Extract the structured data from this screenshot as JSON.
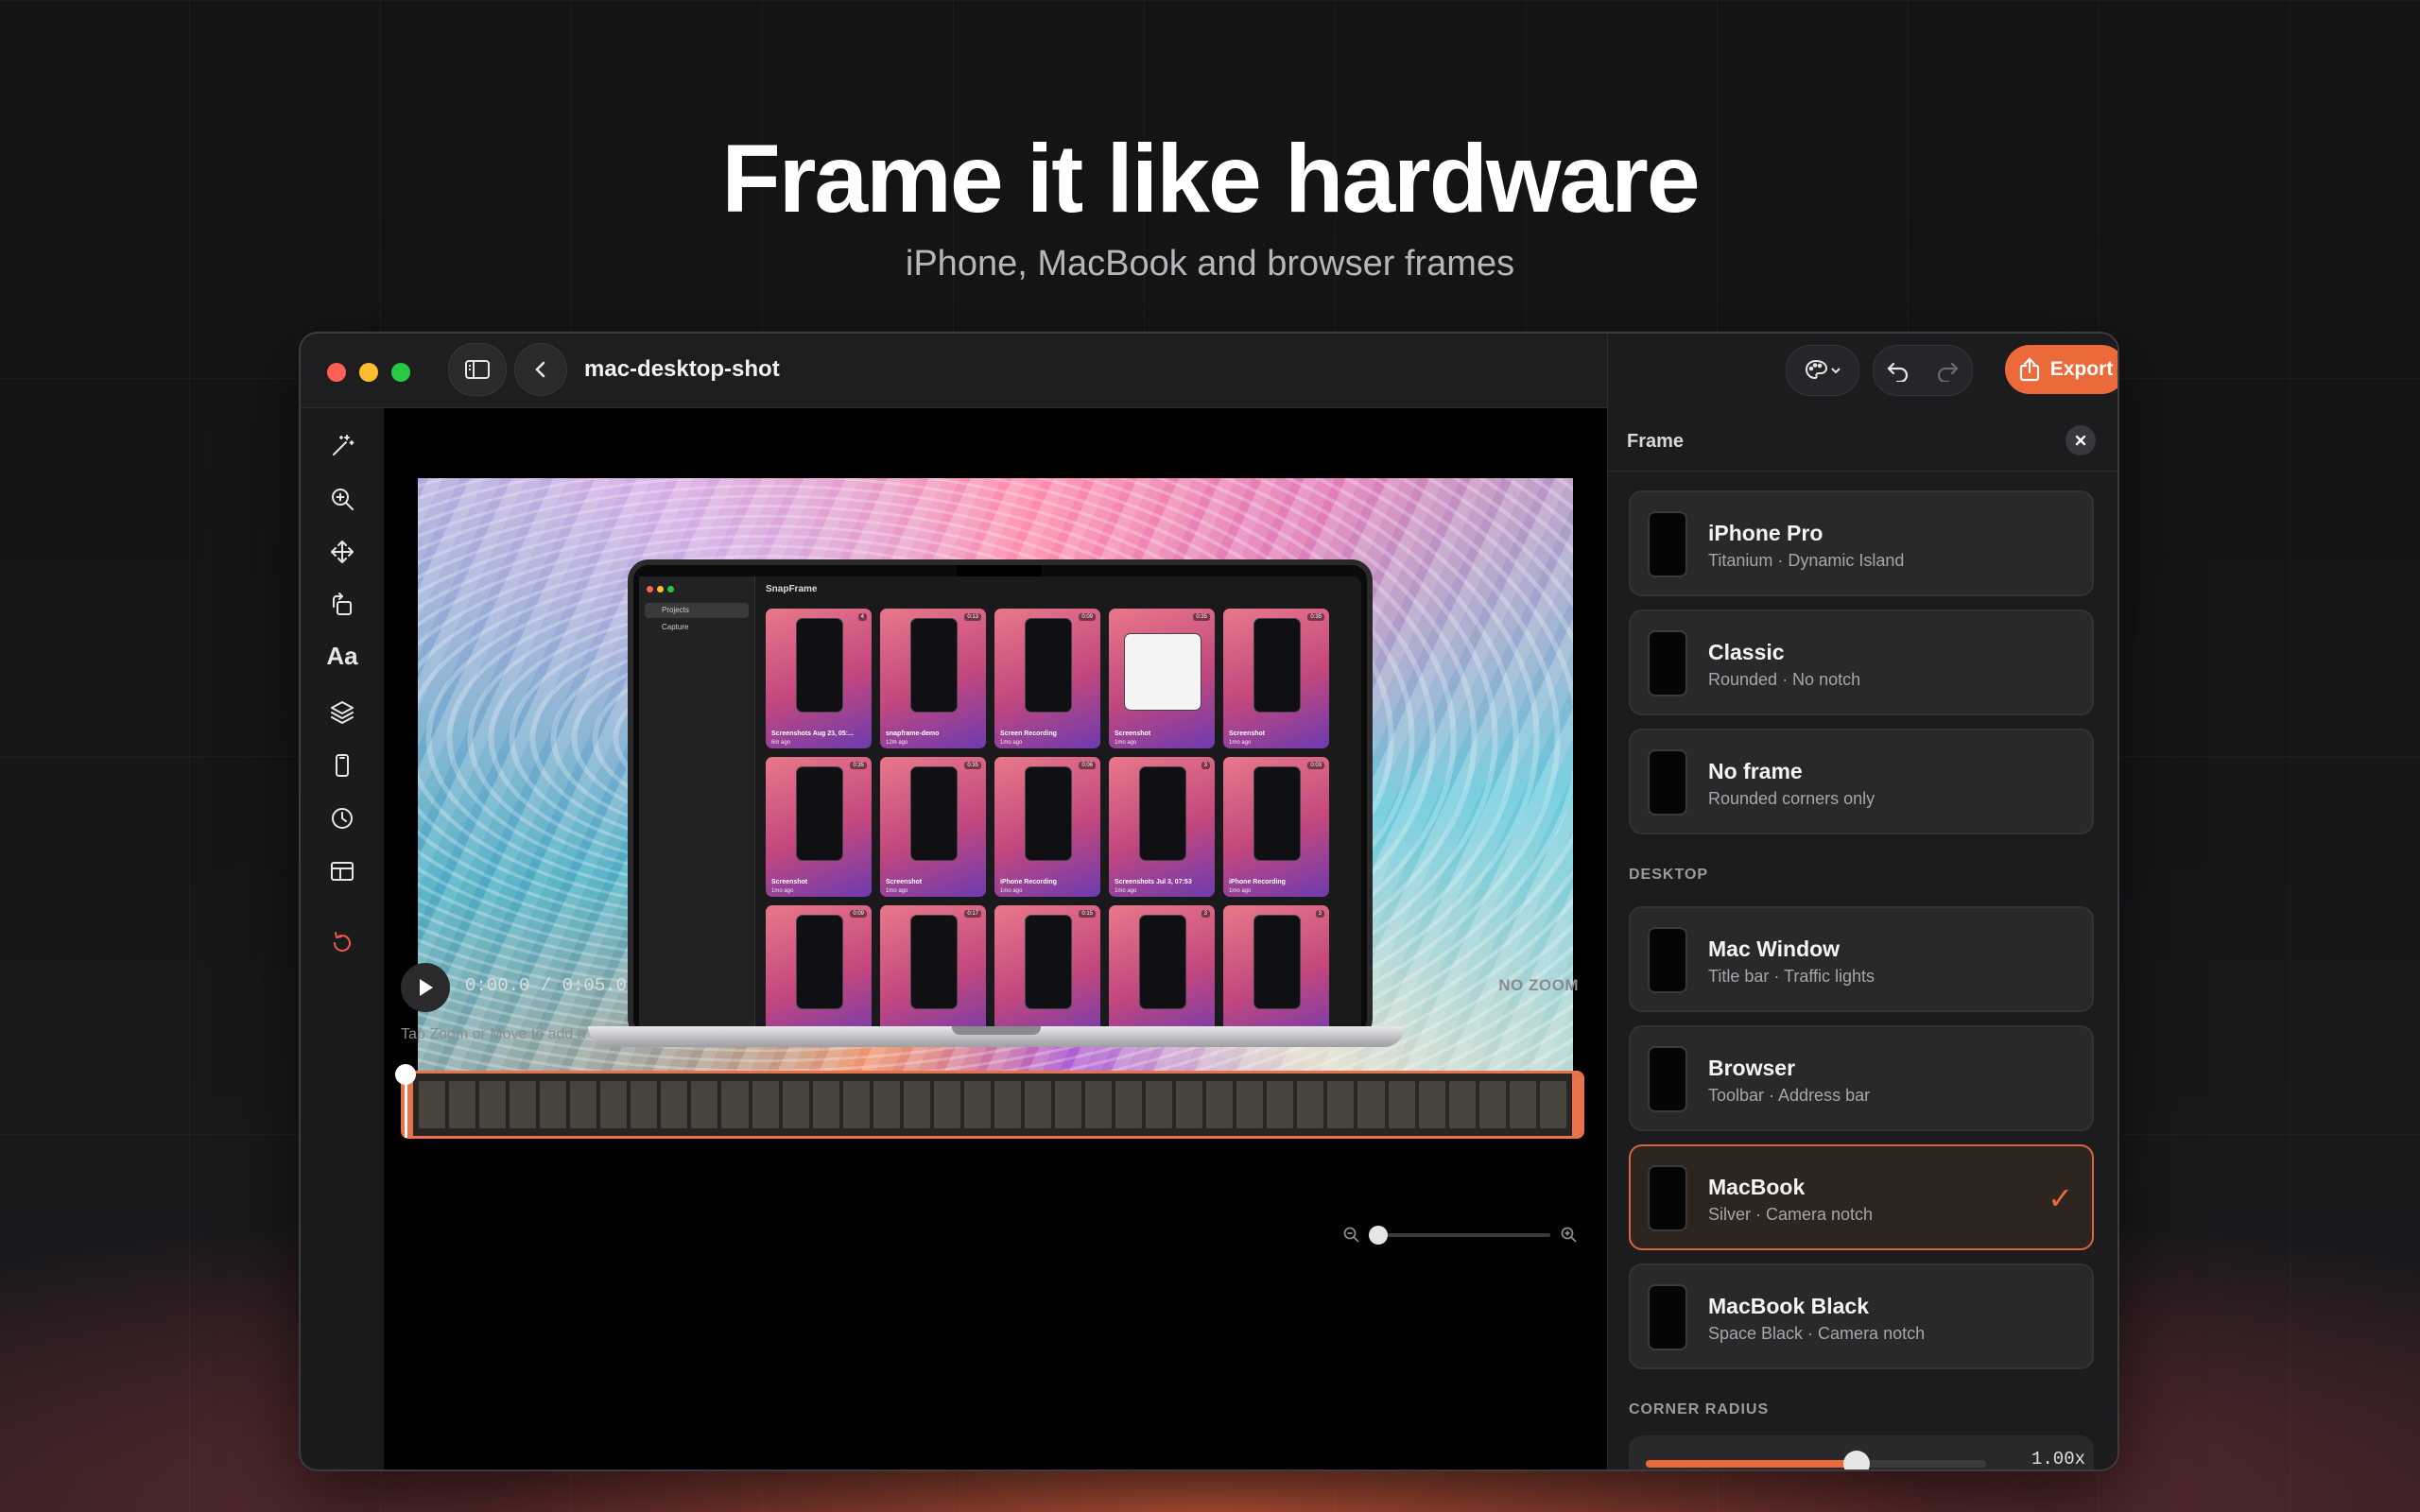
{
  "hero": {
    "title": "Frame it like hardware",
    "subtitle": "iPhone, MacBook and browser frames"
  },
  "window": {
    "title": "mac-desktop-shot",
    "traffic_colors": [
      "#ff5f57",
      "#febc2e",
      "#28c840"
    ]
  },
  "tools": [
    {
      "icon": "magic-wand-icon"
    },
    {
      "icon": "zoom-icon"
    },
    {
      "icon": "move-icon"
    },
    {
      "icon": "rotate-icon"
    },
    {
      "icon": "text-icon",
      "label": "Aa"
    },
    {
      "icon": "layers-icon"
    },
    {
      "icon": "device-frame-icon"
    },
    {
      "icon": "clock-icon"
    },
    {
      "icon": "layout-icon"
    },
    {
      "icon": "reset-icon"
    }
  ],
  "preview": {
    "inner_app_title": "SnapFrame",
    "inner_nav": [
      "Projects",
      "Capture"
    ],
    "thumbs": [
      {
        "caption": "Screenshots Aug 23, 05:...",
        "ago": "6m ago",
        "dur": "4"
      },
      {
        "caption": "snapframe-demo",
        "ago": "12m ago",
        "dur": "0:13"
      },
      {
        "caption": "Screen Recording",
        "ago": "1mo ago",
        "dur": "0:09"
      },
      {
        "caption": "Screenshot",
        "ago": "1mo ago",
        "dur": "0:35"
      },
      {
        "caption": "Screenshot",
        "ago": "1mo ago",
        "dur": "0:35"
      },
      {
        "caption": "Screenshot",
        "ago": "1mo ago",
        "dur": "0:35"
      },
      {
        "caption": "Screenshot",
        "ago": "1mo ago",
        "dur": "0:35"
      },
      {
        "caption": "iPhone Recording",
        "ago": "1mo ago",
        "dur": "0:06"
      },
      {
        "caption": "Screenshots Jul 3, 07:53",
        "ago": "1mo ago",
        "dur": "3"
      },
      {
        "caption": "iPhone Recording",
        "ago": "1mo ago",
        "dur": "0:03"
      },
      {
        "caption": "",
        "ago": "",
        "dur": "0:09"
      },
      {
        "caption": "",
        "ago": "",
        "dur": "0:17"
      },
      {
        "caption": "",
        "ago": "",
        "dur": "0:15"
      },
      {
        "caption": "",
        "ago": "",
        "dur": "3"
      },
      {
        "caption": "",
        "ago": "",
        "dur": "3"
      }
    ]
  },
  "transport": {
    "timecode": "0:00.0 / 0:05.0",
    "zoom_label": "NO ZOOM",
    "hint": "Tap Zoom or Move to add a keyframe at the playhead",
    "playhead_fraction": 0.0
  },
  "panel": {
    "export_label": "Export",
    "title": "Frame",
    "accent": "#ec6a3a",
    "phone_frames": [
      {
        "title": "iPhone Pro",
        "subtitle": "Titanium · Dynamic Island",
        "selected": false
      },
      {
        "title": "Classic",
        "subtitle": "Rounded · No notch",
        "selected": false
      },
      {
        "title": "No frame",
        "subtitle": "Rounded corners only",
        "selected": false
      }
    ],
    "desktop_section": "DESKTOP",
    "desktop_frames": [
      {
        "title": "Mac Window",
        "subtitle": "Title bar · Traffic lights",
        "selected": false
      },
      {
        "title": "Browser",
        "subtitle": "Toolbar · Address bar",
        "selected": false
      },
      {
        "title": "MacBook",
        "subtitle": "Silver · Camera notch",
        "selected": true
      },
      {
        "title": "MacBook Black",
        "subtitle": "Space Black · Camera notch",
        "selected": false
      }
    ],
    "radius_section": "CORNER RADIUS",
    "radius_value": "1.00x",
    "radius_fraction": 0.62
  }
}
